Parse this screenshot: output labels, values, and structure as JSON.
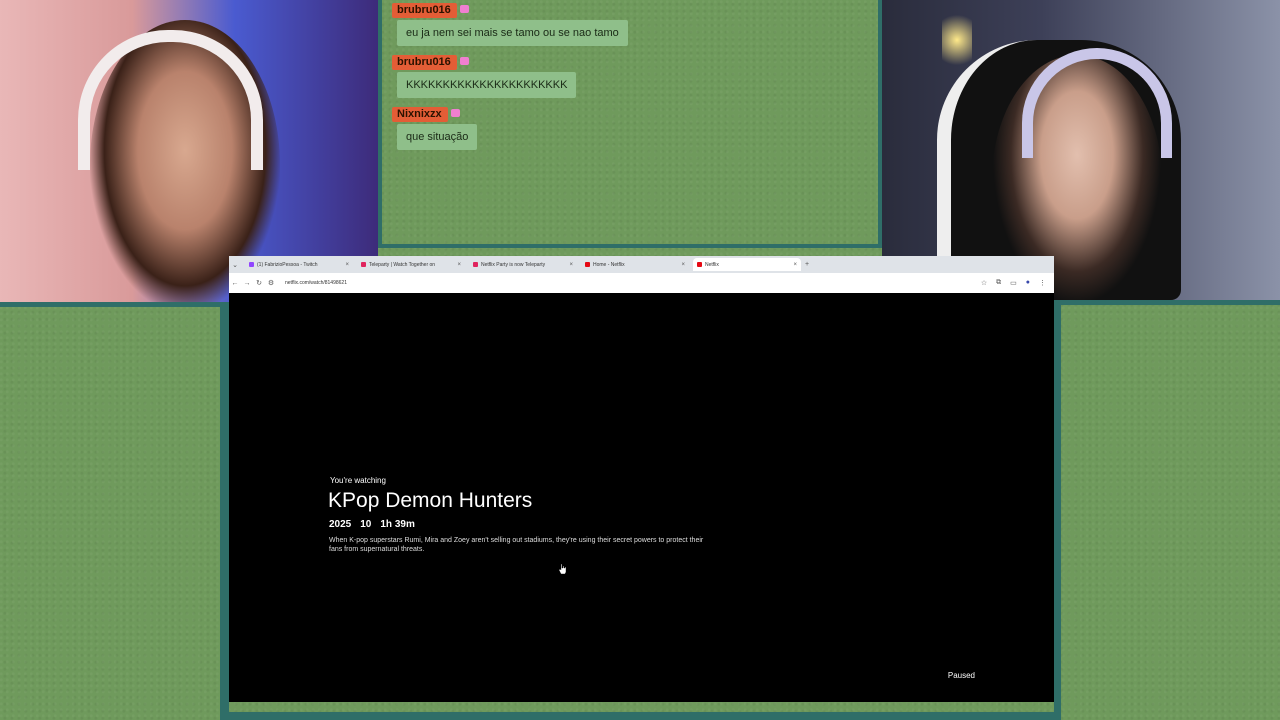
{
  "chat": {
    "messages": [
      {
        "user": "brubru016",
        "text": "eu ja nem sei mais se tamo ou se nao tamo"
      },
      {
        "user": "brubru016",
        "text": "KKKKKKKKKKKKKKKKKKKKKK"
      },
      {
        "user": "Nixnixzx",
        "text": "que situação"
      }
    ]
  },
  "browser": {
    "tabs": [
      {
        "label": "(1) FabrizioPessoa - Twitch",
        "icon": "twitch-icon"
      },
      {
        "label": "Teleparty | Watch Together on",
        "icon": "teleparty-icon"
      },
      {
        "label": "Netflix Party is now Teleparty",
        "icon": "teleparty-icon"
      },
      {
        "label": "Home - Netflix",
        "icon": "netflix-icon"
      },
      {
        "label": "Netflix",
        "icon": "netflix-icon"
      }
    ],
    "url": "netflix.com/watch/81498621"
  },
  "player": {
    "watching_label": "You're watching",
    "title": "KPop Demon Hunters",
    "year": "2025",
    "rating": "10",
    "duration": "1h 39m",
    "description": "When K-pop superstars Rumi, Mira and Zoey aren't selling out stadiums, they're using their secret powers to protect their fans from supernatural threats.",
    "status": "Paused"
  },
  "colors": {
    "background_green": "#6f9a5c",
    "border_teal": "#2f6e68",
    "chat_username_bg": "#e35d36",
    "chat_message_bg": "#8fbf8a"
  }
}
